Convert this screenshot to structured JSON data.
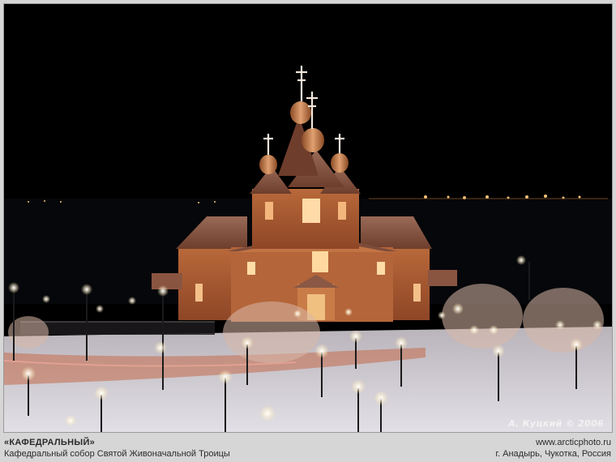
{
  "photo": {
    "signature": "А. Куцкий © 2006",
    "subject": "cathedral-at-night"
  },
  "caption": {
    "title": "«КАФЕДРАЛЬНЫЙ»",
    "subtitle": "Кафедральный собор Святой Живоначальной Троицы",
    "site": "www.arcticphoto.ru",
    "location": "г. Анадырь, Чукотка, Россия"
  },
  "colors": {
    "frame": "#d6d6d6",
    "sky": "#000000",
    "wood": "#a85a2e",
    "roof": "#7a4a35",
    "snow": "#d8d8dc",
    "lamp": "#ffffff"
  }
}
